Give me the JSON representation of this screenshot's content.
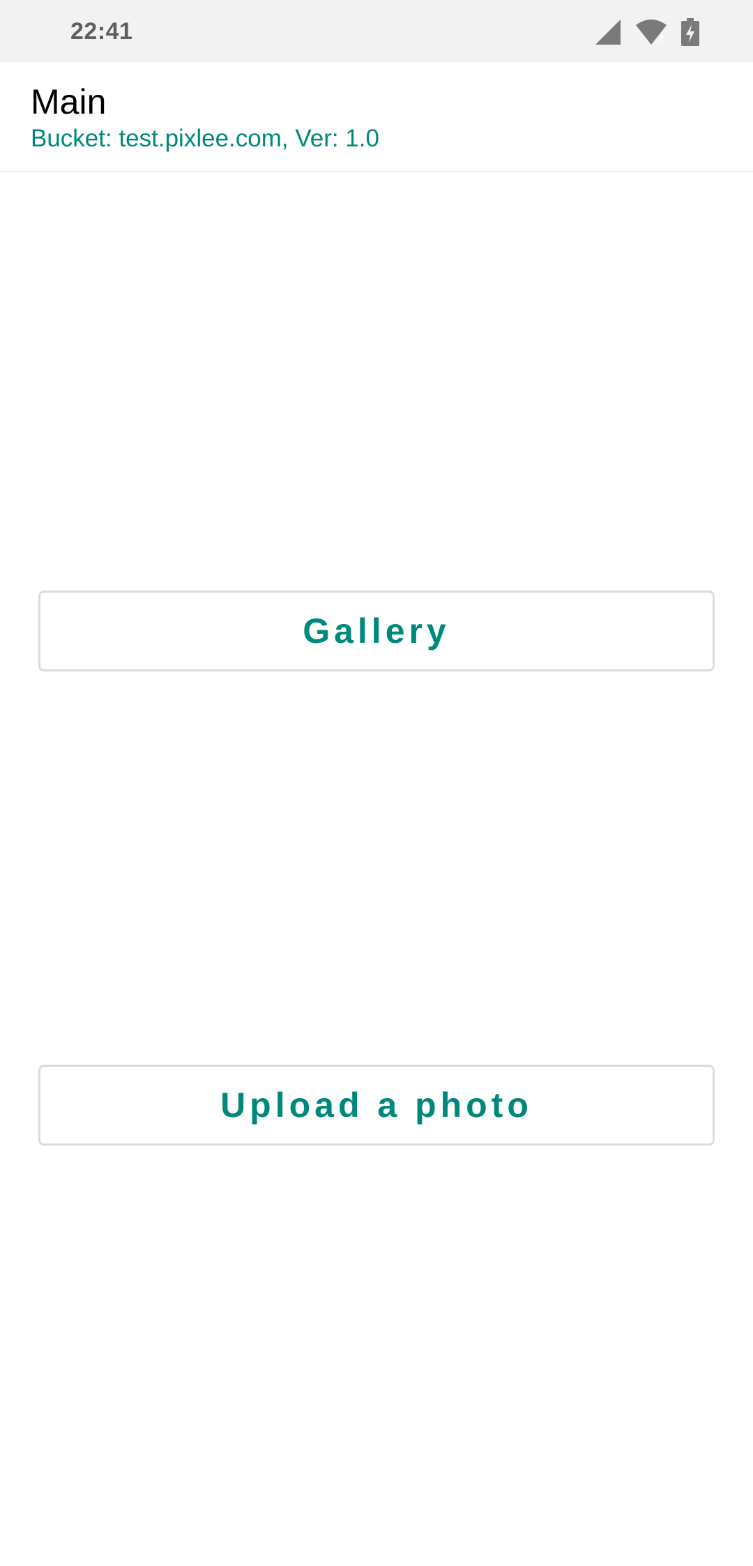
{
  "status_bar": {
    "time": "22:41",
    "icons": [
      "signal-icon",
      "wifi-icon",
      "battery-charging-icon"
    ]
  },
  "app_bar": {
    "title": "Main",
    "subtitle": "Bucket: test.pixlee.com, Ver: 1.0"
  },
  "buttons": {
    "gallery_label": "Gallery",
    "upload_label": "Upload a photo"
  },
  "colors": {
    "accent": "#00897b",
    "status_bar_bg": "#f2f2f2",
    "button_border": "#dcdcdc"
  }
}
